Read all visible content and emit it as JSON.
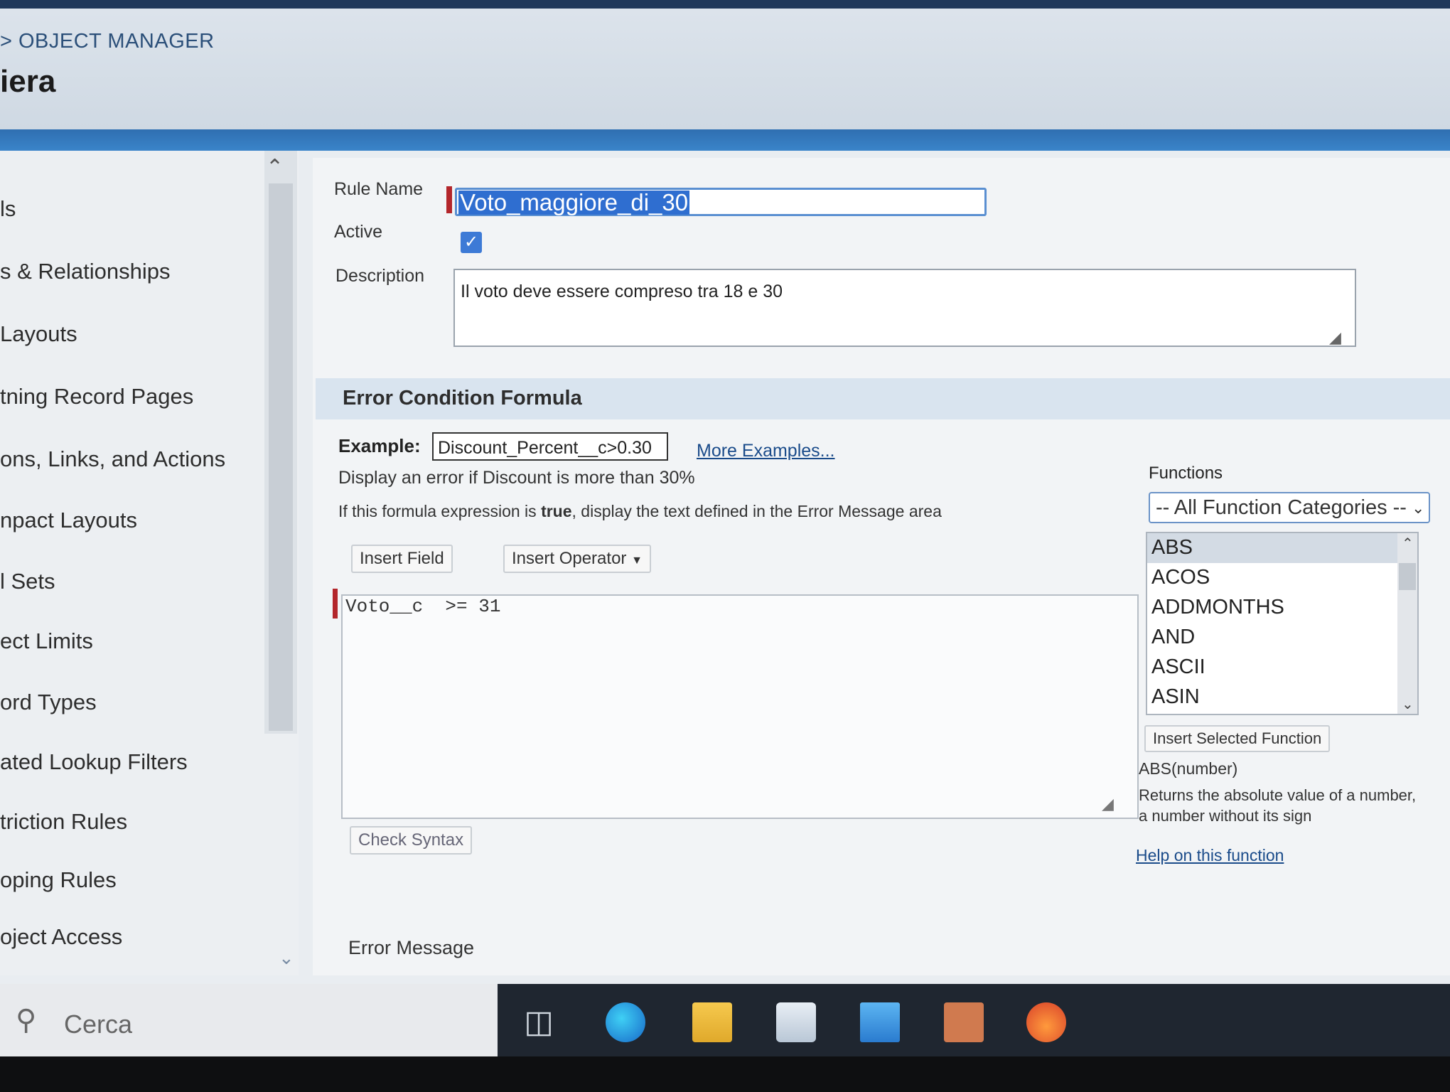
{
  "header": {
    "breadcrumb": "> OBJECT MANAGER",
    "title": "iera"
  },
  "sidebar": {
    "items": [
      {
        "label": "ls"
      },
      {
        "label": "s & Relationships"
      },
      {
        "label": "Layouts"
      },
      {
        "label": "tning Record Pages"
      },
      {
        "label": "ons, Links, and Actions"
      },
      {
        "label": "npact Layouts"
      },
      {
        "label": "l Sets"
      },
      {
        "label": "ect Limits"
      },
      {
        "label": "ord Types"
      },
      {
        "label": "ated Lookup Filters"
      },
      {
        "label": "triction Rules"
      },
      {
        "label": "oping Rules"
      },
      {
        "label": "oject Access"
      }
    ]
  },
  "form": {
    "rule_name_label": "Rule Name",
    "rule_name_value": "Voto_maggiore_di_30",
    "active_label": "Active",
    "description_label": "Description",
    "description_value": "Il voto deve essere compreso tra 18 e 30"
  },
  "formula": {
    "section_title": "Error Condition Formula",
    "example_label": "Example:",
    "example_value": "Discount_Percent__c>0.30",
    "more_examples": "More Examples...",
    "example_description": "Display an error if Discount is more than 30%",
    "hint_prefix": "If this formula expression is ",
    "hint_bold": "true",
    "hint_suffix": ", display the text defined in the Error Message area",
    "insert_field": "Insert Field",
    "insert_operator": "Insert Operator",
    "editor_value": "Voto__c  >= 31",
    "check_syntax": "Check Syntax"
  },
  "functions": {
    "label": "Functions",
    "category": "-- All Function Categories --",
    "items": [
      "ABS",
      "ACOS",
      "ADDMONTHS",
      "AND",
      "ASCII",
      "ASIN"
    ],
    "selected": "ABS",
    "insert_selected": "Insert Selected Function",
    "signature": "ABS(number)",
    "description": "Returns the absolute value of a number, a number without its sign",
    "help_link": "Help on this function"
  },
  "error_message": {
    "label": "Error Message"
  },
  "taskbar": {
    "search_placeholder": "Cerca",
    "icons": [
      "task-view-icon",
      "edge-icon",
      "file-explorer-icon",
      "store-icon",
      "mail-icon",
      "calendar-app-icon",
      "firefox-icon"
    ]
  }
}
